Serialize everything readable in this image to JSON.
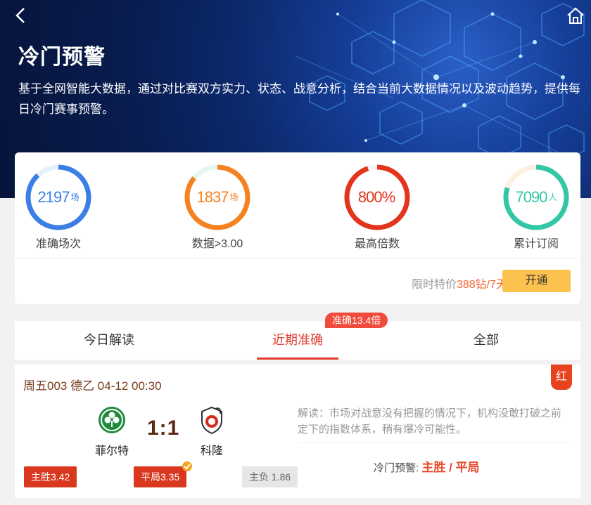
{
  "header": {
    "title": "冷门预警",
    "description": "基于全网智能大数据，通过对比赛双方实力、状态、战意分析，结合当前大数据情况以及波动趋势，提供每日冷门赛事预警。"
  },
  "stats": [
    {
      "value": "2197",
      "unit": "场",
      "label": "准确场次",
      "color": "#3a7ee6",
      "progress": 0.88
    },
    {
      "value": "1837",
      "unit": "场",
      "label": "数据>3.00",
      "color": "#f58220",
      "progress": 0.86
    },
    {
      "value": "800%",
      "unit": "",
      "label": "最高倍数",
      "color": "#e3341c",
      "progress": 0.95
    },
    {
      "value": "7090",
      "unit": "人",
      "label": "累计订阅",
      "color": "#33c7a6",
      "progress": 0.8
    }
  ],
  "promo": {
    "prefix": "限时特价",
    "price": "388钻/7天",
    "button": "开通"
  },
  "tabs": {
    "items": [
      "今日解读",
      "近期准确",
      "全部"
    ],
    "active": "近期准确",
    "badge": "准确13.4倍"
  },
  "match": {
    "header": "周五003 德乙 04-12 00:30",
    "result_tag": "红",
    "home": "菲尔特",
    "away": "科隆",
    "score": "1:1",
    "odds": {
      "home": "主胜3.42",
      "draw": "平局3.35",
      "away": "主负 1.86"
    },
    "analysis": "解读：市场对战意没有把握的情况下，机构没敢打破之前定下的指数体系，稍有爆冷可能性。",
    "warning_label": "冷门预警:",
    "warning_value": "主胜 / 平局"
  },
  "colors": {
    "accent": "#e23b2e",
    "gold": "#fbc24e",
    "home_logo": "#1f8a3a"
  },
  "icons": {
    "back": "chevron-left-icon",
    "home": "home-icon"
  }
}
